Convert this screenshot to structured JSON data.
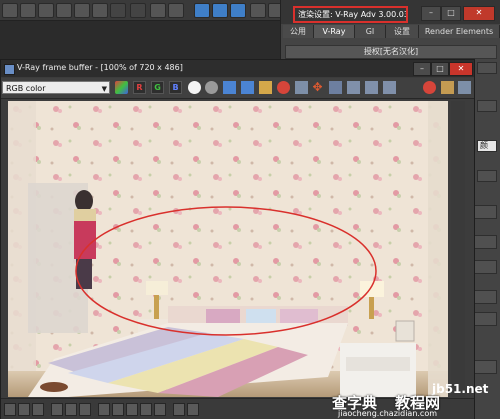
{
  "render_setup": {
    "title": "渲染设置: V-Ray Adv 3.00.03",
    "tabs": [
      "公用",
      "V-Ray",
      "GI",
      "设置",
      "Render Elements"
    ],
    "rollout_title": "授权[无名汉化]",
    "partial_text": "颜"
  },
  "vfb": {
    "title": "V-Ray frame buffer - [100% of 720 x 486]",
    "channel_select": "RGB color",
    "channel_buttons": [
      "R",
      "G",
      "B"
    ]
  },
  "watermark": {
    "domain": "jb51.net",
    "brand": "查字典",
    "section": "教程网",
    "url": "jiaocheng.chazidian.com"
  },
  "colors": {
    "highlight_red": "#d9302c",
    "accent_blue": "#3f7fc8"
  }
}
